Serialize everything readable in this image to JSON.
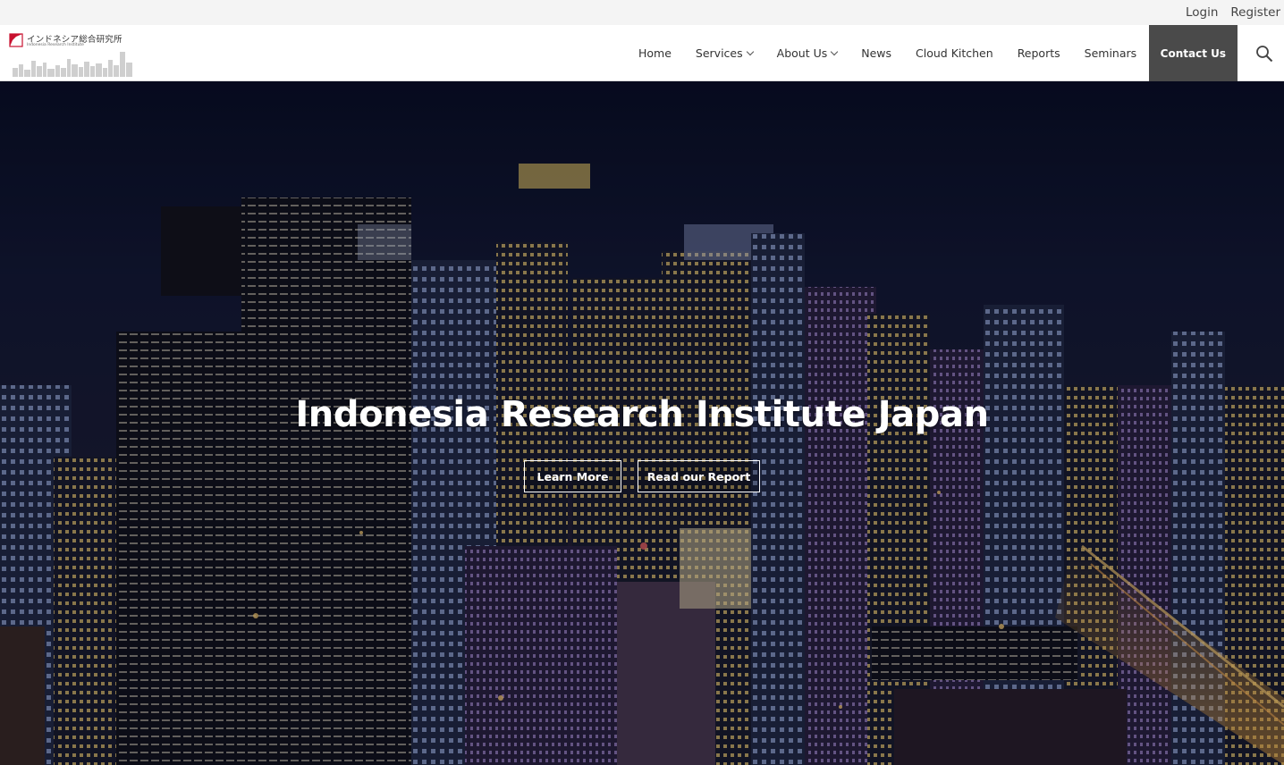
{
  "utility": {
    "login": "Login",
    "register": "Register"
  },
  "logo": {
    "jp_text": "インドネシア総合研究所",
    "en_text": "Indonesia Research Institute"
  },
  "nav": {
    "items": [
      {
        "label": "Home",
        "dropdown": false
      },
      {
        "label": "Services",
        "dropdown": true
      },
      {
        "label": "About Us",
        "dropdown": true
      },
      {
        "label": "News",
        "dropdown": false
      },
      {
        "label": "Cloud Kitchen",
        "dropdown": false
      },
      {
        "label": "Reports",
        "dropdown": false
      },
      {
        "label": "Seminars",
        "dropdown": false
      }
    ],
    "contact": "Contact Us"
  },
  "hero": {
    "title": "Indonesia Research Institute Japan",
    "learn_more": "Learn More",
    "read_report": "Read our Report"
  },
  "colors": {
    "contact_bg": "#4a4a4a",
    "utility_bg": "#f4f4f4",
    "logo_accent": "#c8102e"
  }
}
